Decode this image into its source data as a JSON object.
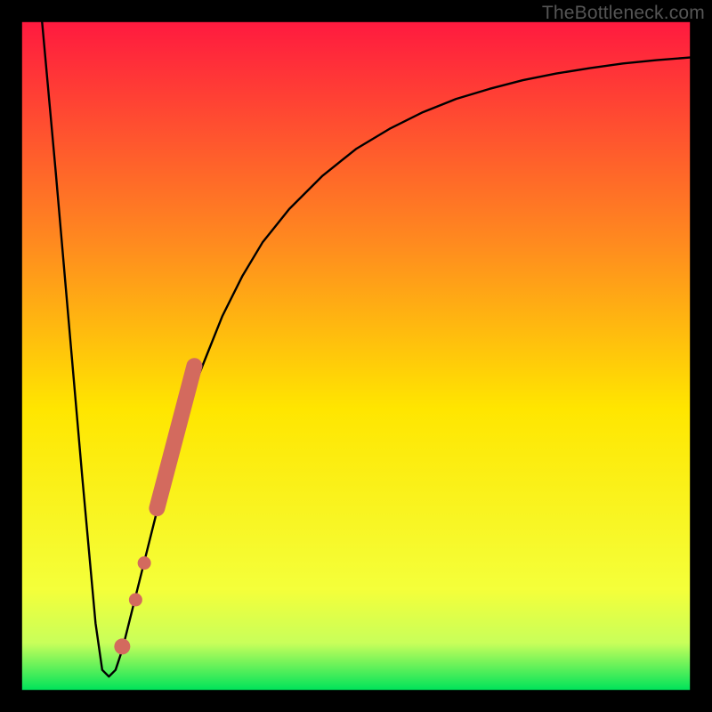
{
  "watermark": "TheBottleneck.com",
  "chart_data": {
    "type": "line",
    "title": "",
    "xlabel": "",
    "ylabel": "",
    "xlim": [
      0,
      100
    ],
    "ylim": [
      0,
      100
    ],
    "grid": false,
    "legend": false,
    "series": [
      {
        "name": "curve",
        "x": [
          3,
          5,
          7,
          9,
          11,
          12,
          13,
          14,
          15,
          16,
          18,
          20,
          22,
          24,
          26,
          28,
          30,
          33,
          36,
          40,
          45,
          50,
          55,
          60,
          65,
          70,
          75,
          80,
          85,
          90,
          95,
          100
        ],
        "y": [
          100,
          78,
          55,
          32,
          10,
          3,
          2,
          3,
          6,
          10,
          18,
          26,
          33,
          40,
          46,
          51,
          56,
          62,
          67,
          72,
          77,
          81,
          84,
          86.5,
          88.5,
          90,
          91.3,
          92.3,
          93.1,
          93.8,
          94.3,
          94.7
        ]
      }
    ],
    "markers": [
      {
        "name": "thick-marker-top",
        "x": 25.8,
        "y": 48.5
      },
      {
        "name": "thick-marker-bottom",
        "x": 20.2,
        "y": 27.2
      },
      {
        "name": "dot-mid-1",
        "x": 18.3,
        "y": 19.0
      },
      {
        "name": "dot-mid-2",
        "x": 17.0,
        "y": 13.5
      },
      {
        "name": "dot-low",
        "x": 15.0,
        "y": 6.5
      }
    ],
    "colors": {
      "marker": "#d36a5e",
      "curve": "#000000",
      "border": "#000000",
      "grad_top": "#ff1a3f",
      "grad_mid1": "#ff8a1f",
      "grad_mid2": "#ffe600",
      "grad_mid3": "#f4ff3a",
      "grad_mid4": "#c8ff5a",
      "grad_bot": "#00e35a"
    },
    "border_thickness_pct": 3.1
  }
}
